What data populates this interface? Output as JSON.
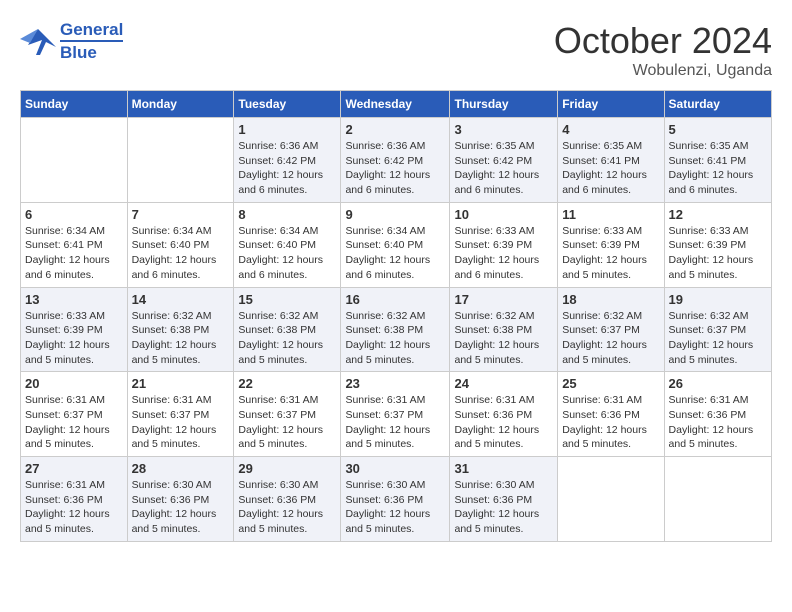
{
  "logo": {
    "line1": "General",
    "line2": "Blue"
  },
  "title": "October 2024",
  "location": "Wobulenzi, Uganda",
  "days_of_week": [
    "Sunday",
    "Monday",
    "Tuesday",
    "Wednesday",
    "Thursday",
    "Friday",
    "Saturday"
  ],
  "weeks": [
    [
      {
        "num": "",
        "info": ""
      },
      {
        "num": "",
        "info": ""
      },
      {
        "num": "1",
        "info": "Sunrise: 6:36 AM\nSunset: 6:42 PM\nDaylight: 12 hours\nand 6 minutes."
      },
      {
        "num": "2",
        "info": "Sunrise: 6:36 AM\nSunset: 6:42 PM\nDaylight: 12 hours\nand 6 minutes."
      },
      {
        "num": "3",
        "info": "Sunrise: 6:35 AM\nSunset: 6:42 PM\nDaylight: 12 hours\nand 6 minutes."
      },
      {
        "num": "4",
        "info": "Sunrise: 6:35 AM\nSunset: 6:41 PM\nDaylight: 12 hours\nand 6 minutes."
      },
      {
        "num": "5",
        "info": "Sunrise: 6:35 AM\nSunset: 6:41 PM\nDaylight: 12 hours\nand 6 minutes."
      }
    ],
    [
      {
        "num": "6",
        "info": "Sunrise: 6:34 AM\nSunset: 6:41 PM\nDaylight: 12 hours\nand 6 minutes."
      },
      {
        "num": "7",
        "info": "Sunrise: 6:34 AM\nSunset: 6:40 PM\nDaylight: 12 hours\nand 6 minutes."
      },
      {
        "num": "8",
        "info": "Sunrise: 6:34 AM\nSunset: 6:40 PM\nDaylight: 12 hours\nand 6 minutes."
      },
      {
        "num": "9",
        "info": "Sunrise: 6:34 AM\nSunset: 6:40 PM\nDaylight: 12 hours\nand 6 minutes."
      },
      {
        "num": "10",
        "info": "Sunrise: 6:33 AM\nSunset: 6:39 PM\nDaylight: 12 hours\nand 6 minutes."
      },
      {
        "num": "11",
        "info": "Sunrise: 6:33 AM\nSunset: 6:39 PM\nDaylight: 12 hours\nand 5 minutes."
      },
      {
        "num": "12",
        "info": "Sunrise: 6:33 AM\nSunset: 6:39 PM\nDaylight: 12 hours\nand 5 minutes."
      }
    ],
    [
      {
        "num": "13",
        "info": "Sunrise: 6:33 AM\nSunset: 6:39 PM\nDaylight: 12 hours\nand 5 minutes."
      },
      {
        "num": "14",
        "info": "Sunrise: 6:32 AM\nSunset: 6:38 PM\nDaylight: 12 hours\nand 5 minutes."
      },
      {
        "num": "15",
        "info": "Sunrise: 6:32 AM\nSunset: 6:38 PM\nDaylight: 12 hours\nand 5 minutes."
      },
      {
        "num": "16",
        "info": "Sunrise: 6:32 AM\nSunset: 6:38 PM\nDaylight: 12 hours\nand 5 minutes."
      },
      {
        "num": "17",
        "info": "Sunrise: 6:32 AM\nSunset: 6:38 PM\nDaylight: 12 hours\nand 5 minutes."
      },
      {
        "num": "18",
        "info": "Sunrise: 6:32 AM\nSunset: 6:37 PM\nDaylight: 12 hours\nand 5 minutes."
      },
      {
        "num": "19",
        "info": "Sunrise: 6:32 AM\nSunset: 6:37 PM\nDaylight: 12 hours\nand 5 minutes."
      }
    ],
    [
      {
        "num": "20",
        "info": "Sunrise: 6:31 AM\nSunset: 6:37 PM\nDaylight: 12 hours\nand 5 minutes."
      },
      {
        "num": "21",
        "info": "Sunrise: 6:31 AM\nSunset: 6:37 PM\nDaylight: 12 hours\nand 5 minutes."
      },
      {
        "num": "22",
        "info": "Sunrise: 6:31 AM\nSunset: 6:37 PM\nDaylight: 12 hours\nand 5 minutes."
      },
      {
        "num": "23",
        "info": "Sunrise: 6:31 AM\nSunset: 6:37 PM\nDaylight: 12 hours\nand 5 minutes."
      },
      {
        "num": "24",
        "info": "Sunrise: 6:31 AM\nSunset: 6:36 PM\nDaylight: 12 hours\nand 5 minutes."
      },
      {
        "num": "25",
        "info": "Sunrise: 6:31 AM\nSunset: 6:36 PM\nDaylight: 12 hours\nand 5 minutes."
      },
      {
        "num": "26",
        "info": "Sunrise: 6:31 AM\nSunset: 6:36 PM\nDaylight: 12 hours\nand 5 minutes."
      }
    ],
    [
      {
        "num": "27",
        "info": "Sunrise: 6:31 AM\nSunset: 6:36 PM\nDaylight: 12 hours\nand 5 minutes."
      },
      {
        "num": "28",
        "info": "Sunrise: 6:30 AM\nSunset: 6:36 PM\nDaylight: 12 hours\nand 5 minutes."
      },
      {
        "num": "29",
        "info": "Sunrise: 6:30 AM\nSunset: 6:36 PM\nDaylight: 12 hours\nand 5 minutes."
      },
      {
        "num": "30",
        "info": "Sunrise: 6:30 AM\nSunset: 6:36 PM\nDaylight: 12 hours\nand 5 minutes."
      },
      {
        "num": "31",
        "info": "Sunrise: 6:30 AM\nSunset: 6:36 PM\nDaylight: 12 hours\nand 5 minutes."
      },
      {
        "num": "",
        "info": ""
      },
      {
        "num": "",
        "info": ""
      }
    ]
  ]
}
